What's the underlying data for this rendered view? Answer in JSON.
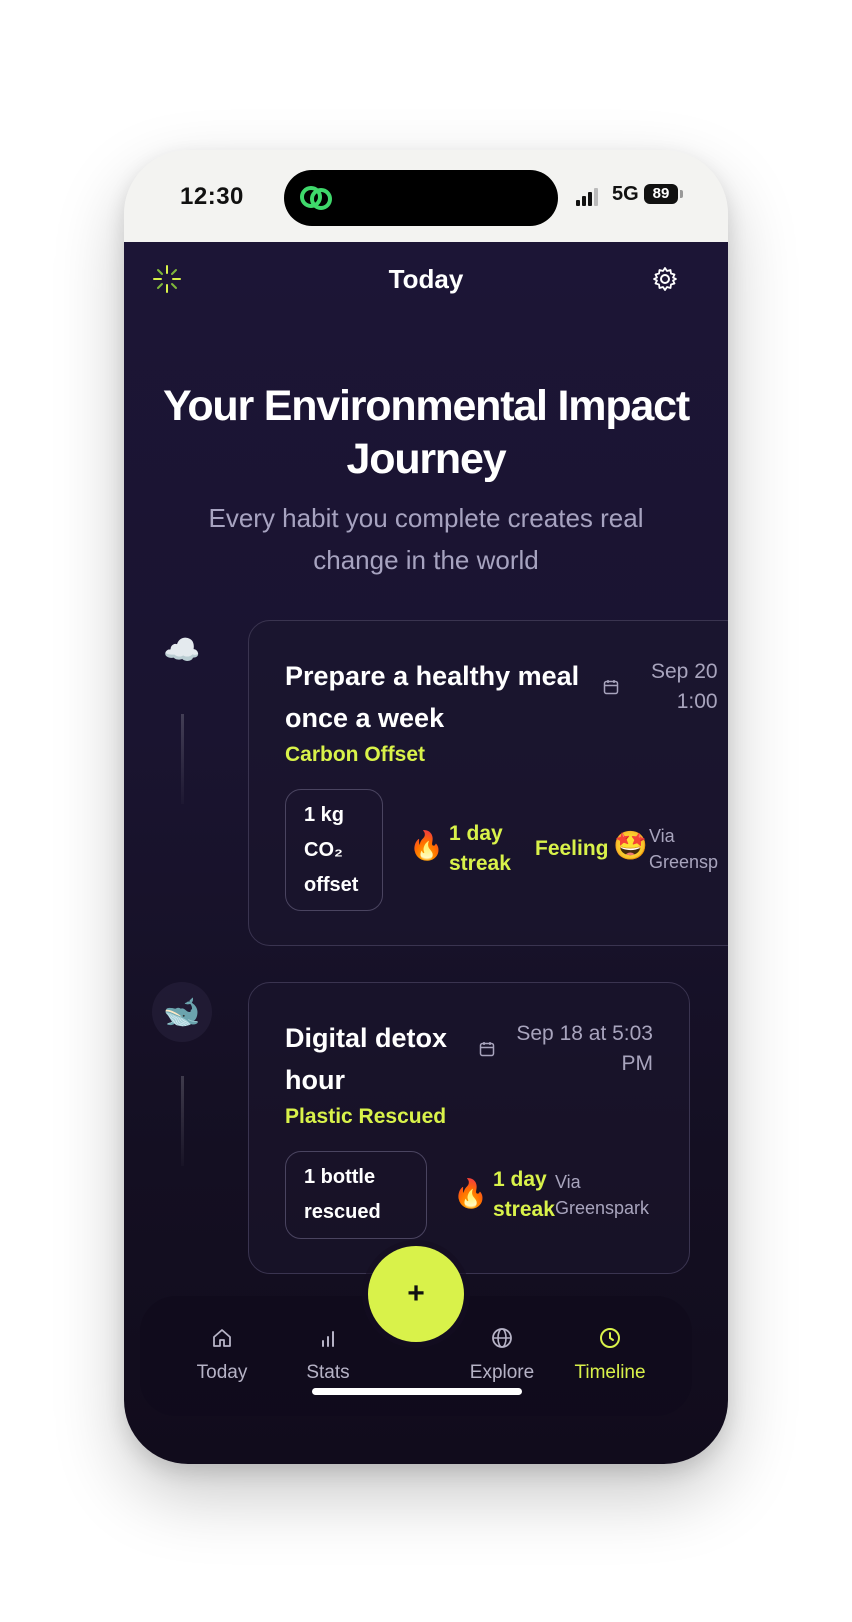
{
  "status_bar": {
    "time": "12:30",
    "network": "5G",
    "battery": "89"
  },
  "header": {
    "title": "Today",
    "left_icon": "sparkle-icon",
    "right_icon": "gear-icon"
  },
  "hero": {
    "title_line1": "Your Environmental Impact",
    "title_line2": "Journey",
    "subtitle_line1": "Every habit you complete creates real",
    "subtitle_line2": "change in the world"
  },
  "timeline": [
    {
      "icon": "☁️",
      "title_line1": "Prepare a healthy meal",
      "title_line2": "once a week",
      "category": "Carbon Offset",
      "date_line1": "Sep 20",
      "date_line2": "1:00",
      "impact_line1": "1 kg",
      "impact_line2": "CO₂",
      "impact_line3": "offset",
      "streak_line1": "1 day",
      "streak_line2": "streak",
      "feeling_label": "Feeling",
      "feeling_emoji": "🤩",
      "via_line1": "Via",
      "via_line2": "Greensp"
    },
    {
      "icon": "🐋",
      "title_line1": "Digital detox",
      "title_line2": "hour",
      "category": "Plastic Rescued",
      "date_line1": "Sep 18 at 5:03",
      "date_line2": "PM",
      "impact_line1": "1 bottle",
      "impact_line2": "rescued",
      "streak_line1": "1 day",
      "streak_line2": "streak",
      "via_line1": "Via",
      "via_line2": "Greenspark"
    }
  ],
  "fab": {
    "label": "+"
  },
  "tabs": [
    {
      "label": "Today",
      "icon": "home-icon"
    },
    {
      "label": "Stats",
      "icon": "bar-chart-icon"
    },
    {
      "label": "Explore",
      "icon": "globe-icon"
    },
    {
      "label": "Timeline",
      "icon": "clock-icon",
      "active": true
    }
  ],
  "colors": {
    "accent": "#d9f24a",
    "background": "#1a1430",
    "muted": "#a8a4bd"
  }
}
